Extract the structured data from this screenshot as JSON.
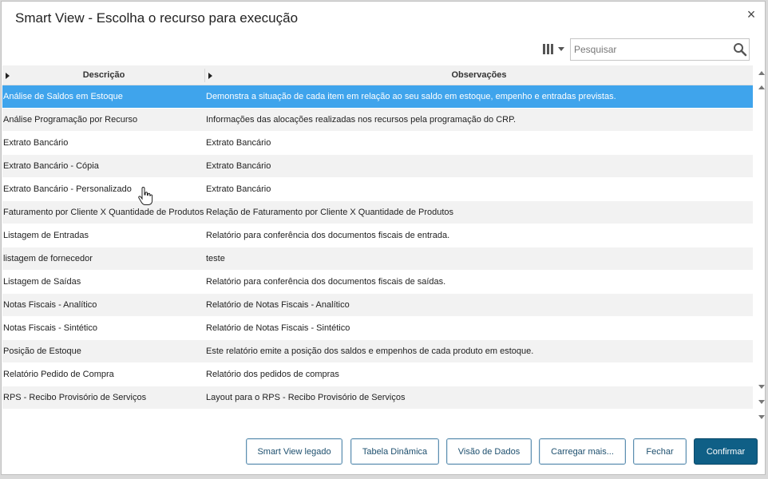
{
  "dialog": {
    "title": "Smart View - Escolha o recurso para execução",
    "close_glyph": "×"
  },
  "toolbar": {
    "columns_icon": "columns-icon",
    "search_placeholder": "Pesquisar",
    "search_value": "",
    "search_icon": "search-icon"
  },
  "table": {
    "columns": [
      "Descrição",
      "Observações"
    ],
    "selected_row": 0,
    "rows": [
      {
        "descricao": "Análise de Saldos em Estoque",
        "observacoes": "Demonstra a situação de cada item em relação ao seu saldo em estoque, empenho e entradas previstas."
      },
      {
        "descricao": "Análise Programação por Recurso",
        "observacoes": "Informações das alocações realizadas nos recursos pela programação do CRP."
      },
      {
        "descricao": "Extrato Bancário",
        "observacoes": "Extrato Bancário"
      },
      {
        "descricao": "Extrato Bancário - Cópia",
        "observacoes": "Extrato Bancário"
      },
      {
        "descricao": "Extrato Bancário - Personalizado",
        "observacoes": "Extrato Bancário"
      },
      {
        "descricao": "Faturamento por Cliente X Quantidade de Produtos",
        "observacoes": "Relação de Faturamento por Cliente X Quantidade de Produtos"
      },
      {
        "descricao": "Listagem de Entradas",
        "observacoes": "Relatório para conferência dos documentos fiscais de entrada."
      },
      {
        "descricao": "listagem de fornecedor",
        "observacoes": "teste"
      },
      {
        "descricao": "Listagem de Saídas",
        "observacoes": "Relatório para conferência dos documentos fiscais de saídas."
      },
      {
        "descricao": "Notas Fiscais - Analítico",
        "observacoes": "Relatório de Notas Fiscais - Analítico"
      },
      {
        "descricao": "Notas Fiscais - Sintético",
        "observacoes": "Relatório de Notas Fiscais - Sintético"
      },
      {
        "descricao": "Posição de Estoque",
        "observacoes": "Este relatório emite a posição dos saldos e empenhos de cada produto em estoque."
      },
      {
        "descricao": "Relatório Pedido de Compra",
        "observacoes": "Relatório dos pedidos de compras"
      },
      {
        "descricao": "RPS - Recibo Provisório de Serviços",
        "observacoes": "Layout para o RPS - Recibo Provisório de Serviços"
      }
    ]
  },
  "buttons": {
    "smart_view_legado": "Smart View legado",
    "tabela_dinamica": "Tabela Dinâmica",
    "visao_de_dados": "Visão de Dados",
    "carregar_mais": "Carregar mais...",
    "fechar": "Fechar",
    "confirmar": "Confirmar"
  },
  "colors": {
    "selected_row": "#3fa4ec",
    "primary_button": "#0f5f86",
    "button_border": "#5d8fb0"
  }
}
